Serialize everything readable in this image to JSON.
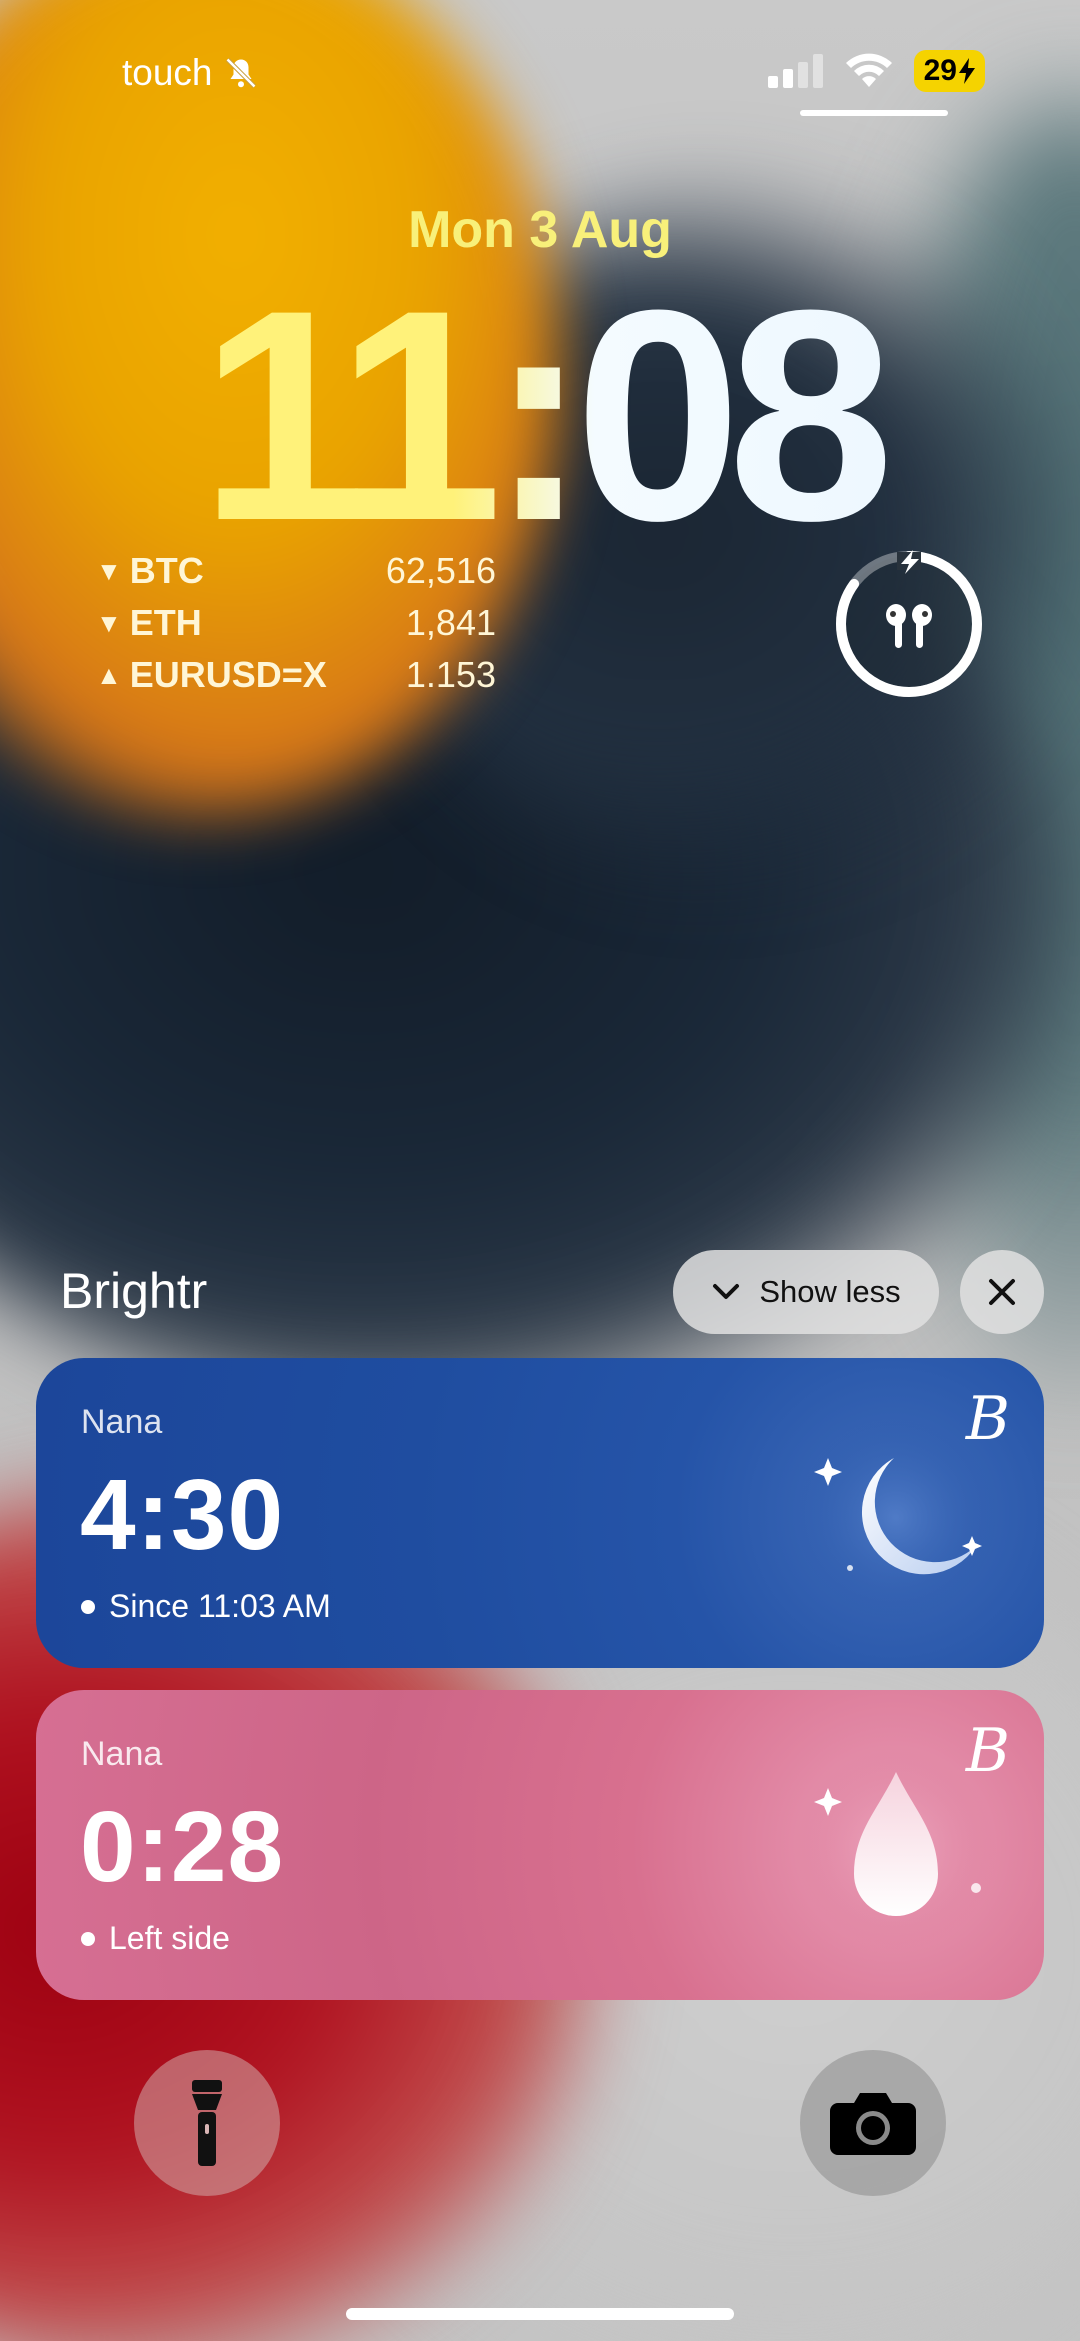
{
  "status_bar": {
    "carrier": "touch",
    "battery": "29"
  },
  "lock_screen": {
    "date": "Mon 3 Aug",
    "time": "11:08"
  },
  "stocks": [
    {
      "symbol": "BTC",
      "direction": "down",
      "value": "62,516"
    },
    {
      "symbol": "ETH",
      "direction": "down",
      "value": "1,841"
    },
    {
      "symbol": "EURUSD=X",
      "direction": "up",
      "value": "1.153"
    }
  ],
  "airpods": {
    "icon": "airpods-icon",
    "charge_fraction": 0.85
  },
  "notifications": {
    "app": "Brightr",
    "show_less_label": "Show less",
    "cards": [
      {
        "name": "Nana",
        "value": "4:30",
        "sub": "Since 11:03 AM",
        "icon": "moon-icon",
        "logo": "B"
      },
      {
        "name": "Nana",
        "value": "0:28",
        "sub": "Left side",
        "icon": "droplet-icon",
        "logo": "B"
      }
    ]
  },
  "colors": {
    "accent_yellow": "#f5d300",
    "sleep_card": "#1f4da0",
    "feed_card": "#cd6587"
  }
}
